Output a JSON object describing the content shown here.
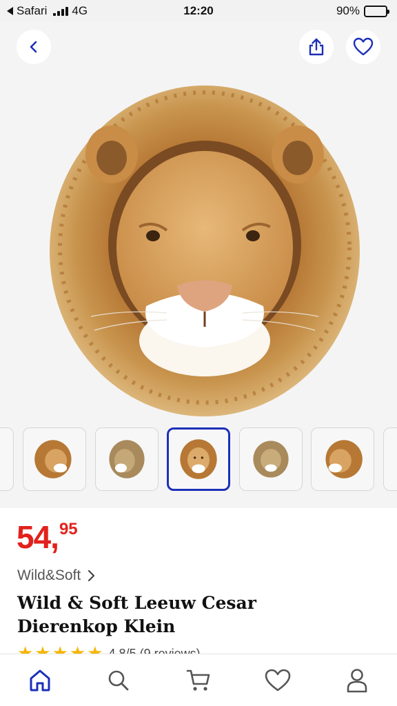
{
  "status_bar": {
    "carrier": "Safari",
    "network": "4G",
    "time": "12:20",
    "battery": "90%",
    "battery_level": 0.9
  },
  "header": {
    "back_icon": "chevron-left-icon",
    "share_icon": "share-icon",
    "favorite_icon": "heart-icon",
    "accent_color": "#1c2fb8"
  },
  "gallery": {
    "selected_index": 3,
    "thumbnail_count": 7
  },
  "product": {
    "price_whole": "54,",
    "price_cents": "95",
    "price_color": "#e2211c",
    "brand": "Wild&Soft",
    "title_line1": "Wild & Soft Leeuw Cesar",
    "title_line2": "Dierenkop Klein",
    "rating_text": "4,8/5 (9 reviews)",
    "rating_stars": 5
  },
  "bottom_nav": {
    "items": [
      {
        "icon": "home-icon",
        "active": true
      },
      {
        "icon": "search-icon",
        "active": false
      },
      {
        "icon": "cart-icon",
        "active": false
      },
      {
        "icon": "heart-icon",
        "active": false
      },
      {
        "icon": "user-icon",
        "active": false
      }
    ],
    "active_color": "#1c2fb8",
    "inactive_color": "#555555"
  }
}
